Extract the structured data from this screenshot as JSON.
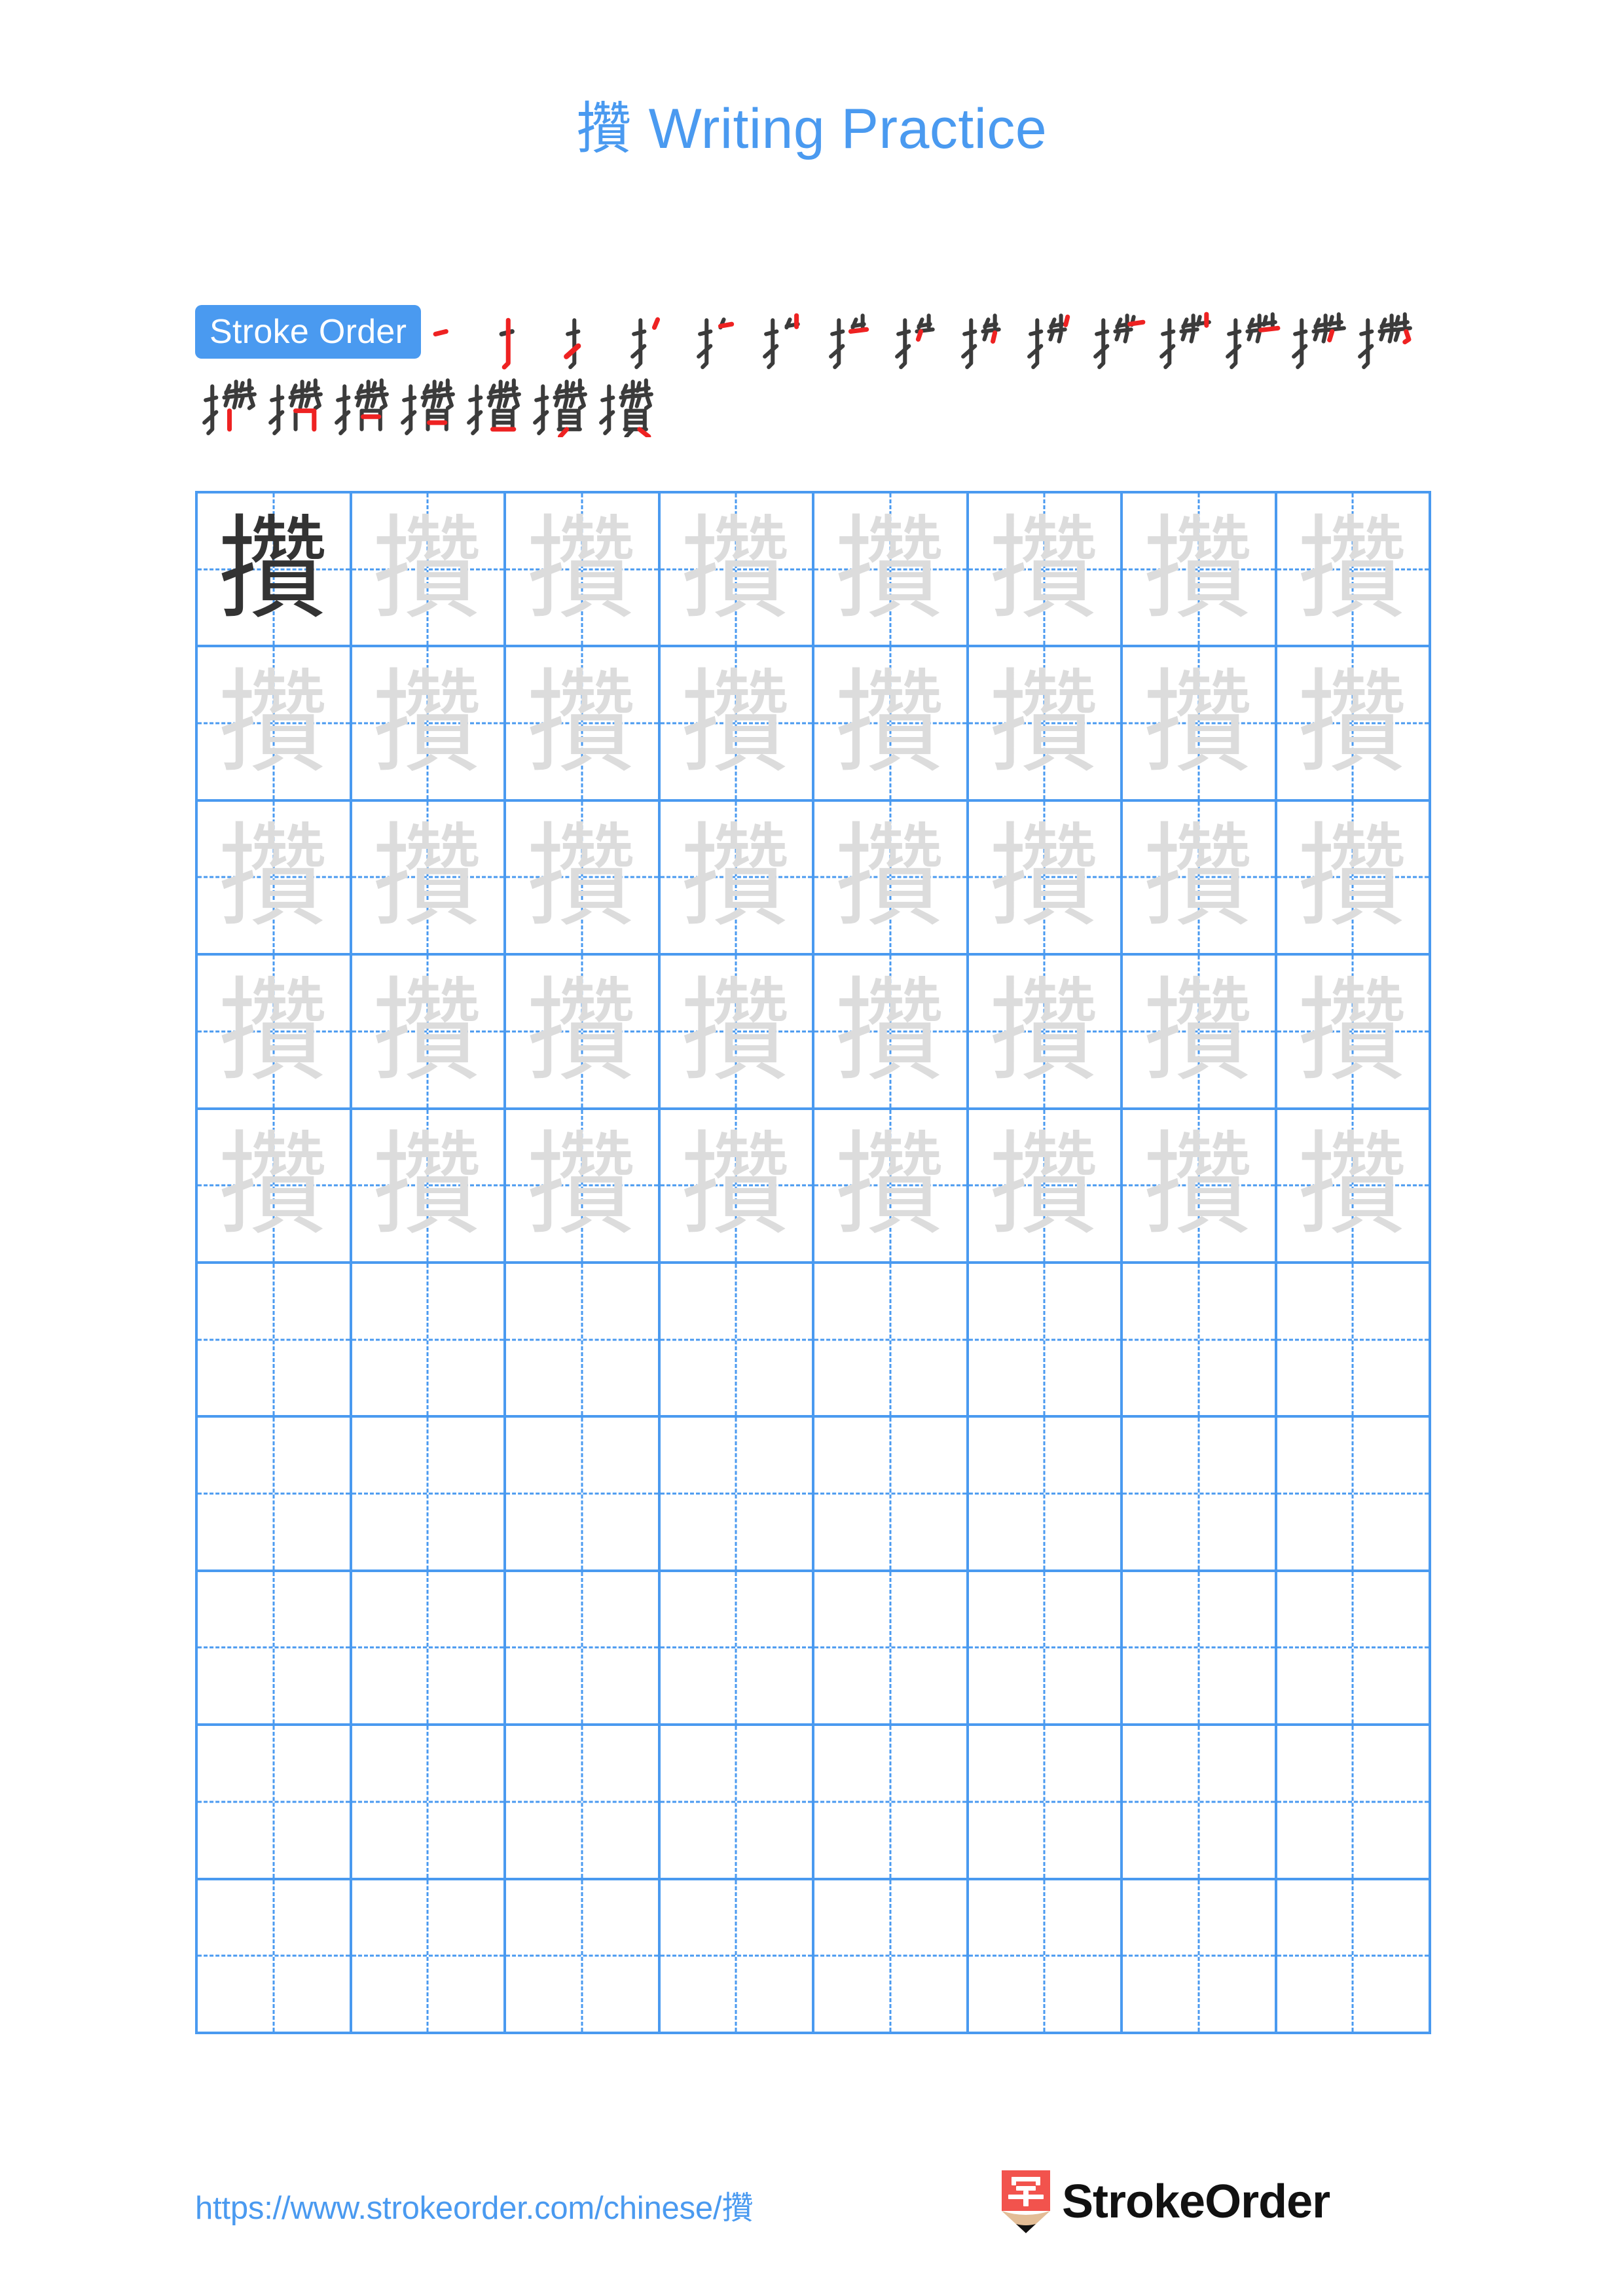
{
  "character": "攢",
  "title": {
    "full": "攢 Writing Practice",
    "character": "攢",
    "label": "Writing Practice"
  },
  "stroke_order": {
    "badge_label": "Stroke Order",
    "total_strokes": 22,
    "steps": [
      {
        "index": 1,
        "glyph": "一"
      },
      {
        "index": 2,
        "glyph": "亅"
      },
      {
        "index": 3,
        "glyph": "扌"
      },
      {
        "index": 4,
        "glyph": "扌"
      },
      {
        "index": 5,
        "glyph": "扌"
      },
      {
        "index": 6,
        "glyph": "扌"
      },
      {
        "index": 7,
        "glyph": "扌"
      },
      {
        "index": 8,
        "glyph": "扌"
      },
      {
        "index": 9,
        "glyph": "扌"
      },
      {
        "index": 10,
        "glyph": "扌"
      },
      {
        "index": 11,
        "glyph": "扌"
      },
      {
        "index": 12,
        "glyph": "扌"
      },
      {
        "index": 13,
        "glyph": "攢"
      },
      {
        "index": 14,
        "glyph": "攢"
      },
      {
        "index": 15,
        "glyph": "攢"
      },
      {
        "index": 16,
        "glyph": "攢"
      },
      {
        "index": 17,
        "glyph": "攢"
      },
      {
        "index": 18,
        "glyph": "攢"
      },
      {
        "index": 19,
        "glyph": "攢"
      },
      {
        "index": 20,
        "glyph": "攢"
      },
      {
        "index": 21,
        "glyph": "攢"
      },
      {
        "index": 22,
        "glyph": "攢"
      }
    ]
  },
  "practice_grid": {
    "columns": 8,
    "rows": 10,
    "traced_rows": 5,
    "blank_rows": 5,
    "first_cell_style": "dark",
    "traced_cell_style": "ghost",
    "cell_character": "攢"
  },
  "footer": {
    "url_text": "https://www.strokeorder.com/chinese/攢",
    "url_prefix": "https://www.strokeorder.com/chinese/",
    "url_character": "攢",
    "brand_name": "StrokeOrder",
    "brand_mark_character": "字"
  },
  "colors": {
    "accent_blue": "#4a9af0",
    "stroke_new_red": "#ee2222",
    "stroke_done_dark": "#3b3b3b",
    "ghost_gray": "#dcdcdc",
    "dark_char": "#333333",
    "brand_red": "#f2534d",
    "brand_tan": "#e3bd96"
  }
}
